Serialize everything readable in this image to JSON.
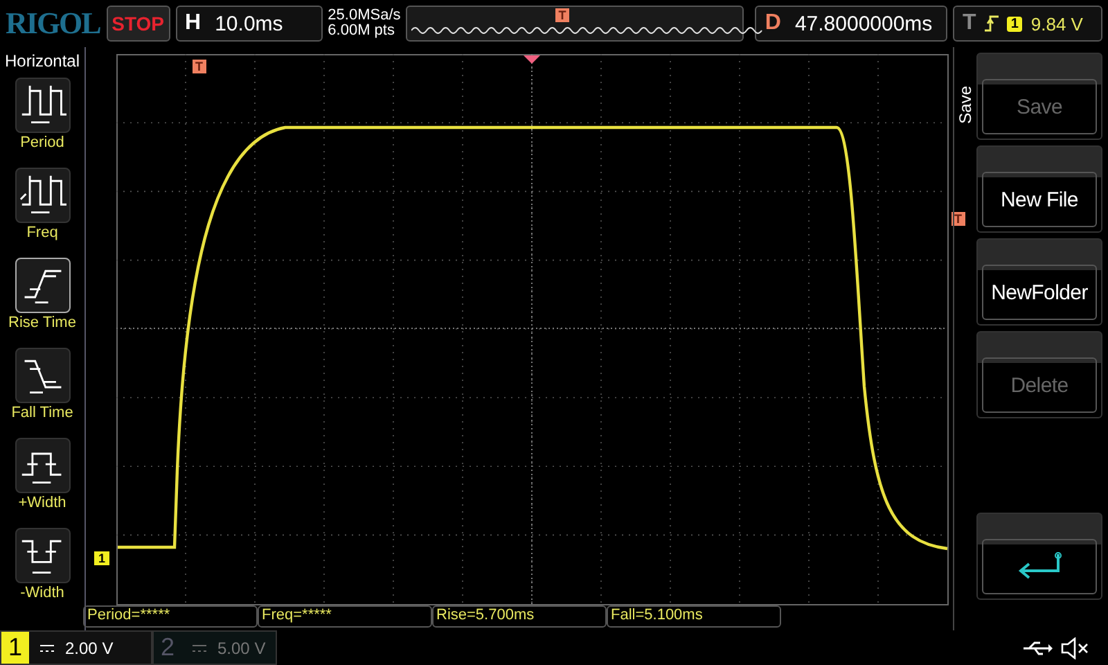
{
  "logo": "RIGOL",
  "run_state": "STOP",
  "timebase": {
    "label": "H",
    "value": "10.0ms"
  },
  "acquisition": {
    "sample_rate": "25.0MSa/s",
    "memory_depth": "6.00M pts"
  },
  "memory_bar": {
    "trigger_marker": "T"
  },
  "delay": {
    "label": "D",
    "value": "47.8000000ms"
  },
  "trigger": {
    "label": "T",
    "source": "1",
    "level": "9.84 V"
  },
  "left_menu": {
    "title": "Horizontal",
    "items": [
      {
        "kind": "period",
        "label": "Period",
        "selected": false
      },
      {
        "kind": "freq",
        "label": "Freq",
        "selected": false
      },
      {
        "kind": "rise",
        "label": "Rise Time",
        "selected": true
      },
      {
        "kind": "fall",
        "label": "Fall Time",
        "selected": false
      },
      {
        "kind": "pwidth",
        "label": "+Width",
        "selected": false
      },
      {
        "kind": "nwidth",
        "label": "-Width",
        "selected": false
      }
    ]
  },
  "screen": {
    "trigger_position_marker": "T",
    "trigger_level_marker": "T",
    "channel_marker": "1"
  },
  "right_menu": {
    "title": "Save",
    "items": [
      {
        "kind": "text",
        "label": "Save",
        "disabled": true
      },
      {
        "kind": "text",
        "label": "New File",
        "disabled": false
      },
      {
        "kind": "text",
        "label": "NewFolder",
        "disabled": false
      },
      {
        "kind": "text",
        "label": "Delete",
        "disabled": true
      },
      {
        "kind": "back"
      }
    ]
  },
  "measurements": [
    "Period=*****",
    "Freq=*****",
    "Rise=5.700ms",
    "Fall=5.100ms"
  ],
  "channels": [
    {
      "number": "1",
      "scale": "2.00 V",
      "selected": true
    },
    {
      "number": "2",
      "scale": "5.00 V",
      "selected": false
    }
  ]
}
